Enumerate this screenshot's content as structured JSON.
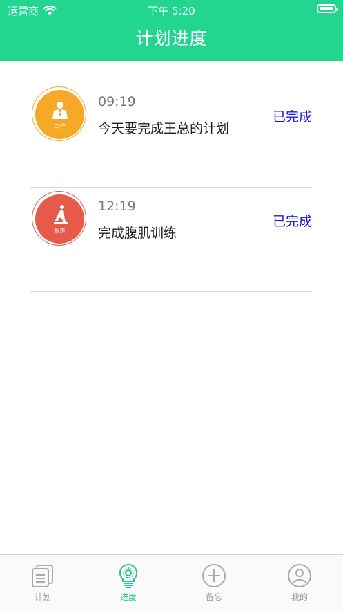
{
  "status_bar": {
    "carrier": "运营商",
    "time": "下午 5:20"
  },
  "header": {
    "title": "计划进度"
  },
  "items": [
    {
      "time": "09:19",
      "text": "今天要完成王总的计划",
      "status": "已完成",
      "category": "工作",
      "color": "#f6a929",
      "icon": "worker-icon"
    },
    {
      "time": "12:19",
      "text": "完成腹肌训练",
      "status": "已完成",
      "category": "锻炼",
      "color": "#e55a48",
      "icon": "exercise-icon"
    }
  ],
  "tabs": [
    {
      "label": "计划",
      "icon": "documents-icon",
      "active": false
    },
    {
      "label": "进度",
      "icon": "lightbulb-icon",
      "active": true
    },
    {
      "label": "备忘",
      "icon": "plus-circle-icon",
      "active": false
    },
    {
      "label": "我的",
      "icon": "user-icon",
      "active": false
    }
  ],
  "colors": {
    "brand": "#22d690",
    "status": "#1a18d6",
    "tab_active": "#22c88a",
    "tab_inactive": "#999999"
  }
}
